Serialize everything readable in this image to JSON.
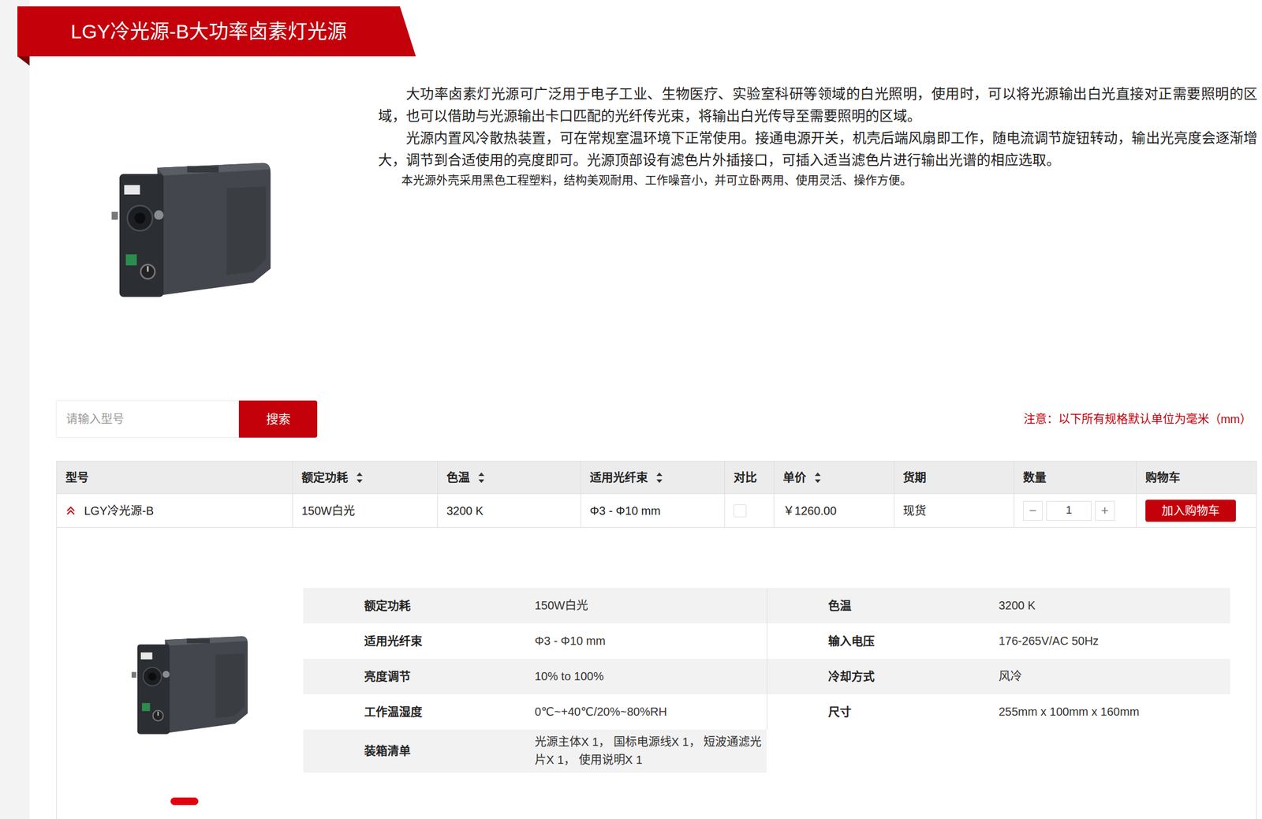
{
  "header": {
    "title": "LGY冷光源-B大功率卤素灯光源"
  },
  "intro": {
    "paragraphs": [
      {
        "text": "大功率卤素灯光源可广泛用于电子工业、生物医疗、实验室科研等领域的白光照明，使用时，可以将光源输出白光直接对正需要照明的区域，也可以借助与光源输出卡口匹配的光纤传光束，将输出白光传导至需要照明的区域。",
        "kind": "body"
      },
      {
        "text": "光源内置风冷散热装置，可在常规室温环境下正常使用。接通电源开关，机壳后端风扇即工作，随电流调节旋钮转动，输出光亮度会逐渐增大，调节到合适使用的亮度即可。光源顶部设有滤色片外插接口，可插入适当滤色片进行输出光谱的相应选取。",
        "kind": "body"
      },
      {
        "text": "本光源外壳采用黑色工程塑料，结构美观耐用、工作噪音小，并可立卧两用、使用灵活、操作方便。",
        "kind": "note"
      }
    ]
  },
  "search": {
    "placeholder": "请输入型号",
    "button": "搜索"
  },
  "note": "注意：以下所有规格默认单位为毫米（mm）",
  "table": {
    "columns": [
      {
        "label": "型号",
        "sortable": false
      },
      {
        "label": "额定功耗",
        "sortable": true
      },
      {
        "label": "色温",
        "sortable": true
      },
      {
        "label": "适用光纤束",
        "sortable": true
      },
      {
        "label": "对比",
        "sortable": false
      },
      {
        "label": "单价",
        "sortable": true
      },
      {
        "label": "货期",
        "sortable": false
      },
      {
        "label": "数量",
        "sortable": false
      },
      {
        "label": "购物车",
        "sortable": false
      }
    ],
    "rows": [
      {
        "expanded": true,
        "model": "LGY冷光源-B",
        "power": "150W白光",
        "color_temp": "3200 K",
        "fiber": "Φ3 - Φ10 mm",
        "compare": false,
        "price": "￥1260.00",
        "delivery": "现货",
        "minus": "−",
        "quantity": "1",
        "plus": "+",
        "cart": "加入购物车"
      }
    ]
  },
  "detail": {
    "specs": [
      {
        "items": [
          {
            "label": "额定功耗",
            "value": "150W白光"
          },
          {
            "label": "色温",
            "value": "3200 K"
          }
        ]
      },
      {
        "items": [
          {
            "label": "适用光纤束",
            "value": "Φ3 - Φ10 mm"
          },
          {
            "label": "输入电压",
            "value": "176-265V/AC 50Hz"
          }
        ]
      },
      {
        "items": [
          {
            "label": "亮度调节",
            "value": "10% to 100%"
          },
          {
            "label": "冷却方式",
            "value": "风冷"
          }
        ]
      },
      {
        "items": [
          {
            "label": "工作温湿度",
            "value": "0℃~+40℃/20%~80%RH"
          },
          {
            "label": "尺寸",
            "value": "255mm x 100mm x 160mm"
          }
        ]
      },
      {
        "items": [
          {
            "label": "装箱清单",
            "value": "光源主体X 1， 国标电源线X 1， 短波通滤光片X 1， 使用说明X 1"
          }
        ]
      }
    ],
    "slides": [
      {
        "selected": true
      }
    ]
  }
}
